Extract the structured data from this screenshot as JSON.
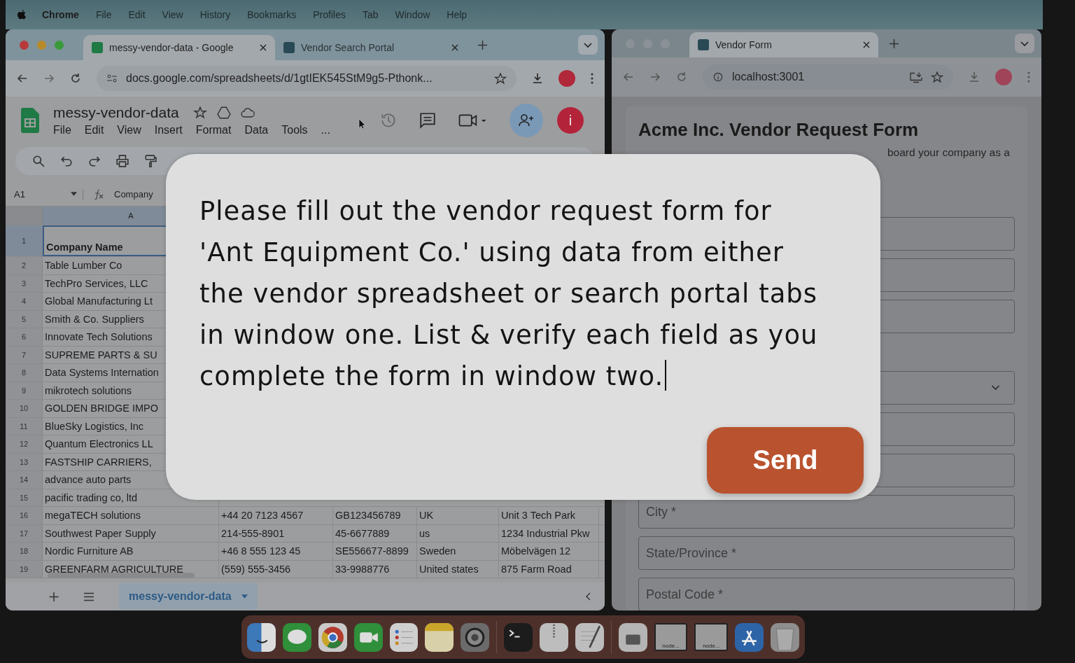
{
  "menu_bar": {
    "app": "Chrome",
    "items": [
      "File",
      "Edit",
      "View",
      "History",
      "Bookmarks",
      "Profiles",
      "Tab",
      "Window",
      "Help"
    ]
  },
  "window_one": {
    "tabs": [
      {
        "title": "messy-vendor-data - Google",
        "kind": "sheets",
        "selected": true
      },
      {
        "title": "Vendor Search Portal",
        "kind": "portal",
        "selected": false
      }
    ],
    "address": "docs.google.com/spreadsheets/d/1gtIEK545StM9g5-Pthonk...",
    "doc_title": "messy-vendor-data",
    "doc_menu": [
      "File",
      "Edit",
      "View",
      "Insert",
      "Format",
      "Data",
      "Tools",
      "..."
    ],
    "avatar_letter": "i",
    "name_box": "A1",
    "formula": "Company",
    "column_header": "A",
    "rows": [
      {
        "number": "1",
        "cells": [
          "Company Name"
        ]
      },
      {
        "number": "2",
        "cells": [
          "Table Lumber Co"
        ]
      },
      {
        "number": "3",
        "cells": [
          "TechPro Services, LLC"
        ]
      },
      {
        "number": "4",
        "cells": [
          "Global Manufacturing Lt"
        ]
      },
      {
        "number": "5",
        "cells": [
          "Smith & Co. Suppliers"
        ]
      },
      {
        "number": "6",
        "cells": [
          "Innovate Tech Solutions"
        ]
      },
      {
        "number": "7",
        "cells": [
          "SUPREME PARTS & SU"
        ]
      },
      {
        "number": "8",
        "cells": [
          "Data Systems Internation"
        ]
      },
      {
        "number": "9",
        "cells": [
          "mikrotech solutions"
        ]
      },
      {
        "number": "10",
        "cells": [
          "GOLDEN BRIDGE IMPO"
        ]
      },
      {
        "number": "11",
        "cells": [
          "BlueSky Logistics, Inc"
        ]
      },
      {
        "number": "12",
        "cells": [
          "Quantum Electronics LL"
        ]
      },
      {
        "number": "13",
        "cells": [
          "FASTSHIP CARRIERS,"
        ]
      },
      {
        "number": "14",
        "cells": [
          "advance auto parts"
        ]
      },
      {
        "number": "15",
        "cells": [
          "pacific trading co, ltd"
        ]
      },
      {
        "number": "16",
        "cells": [
          "megaTECH solutions",
          "+44 20 7123 4567",
          "GB123456789",
          "UK",
          "Unit 3 Tech Park"
        ]
      },
      {
        "number": "17",
        "cells": [
          "Southwest Paper Supply",
          "214-555-8901",
          "45-6677889",
          "us",
          "1234 Industrial Pkw"
        ]
      },
      {
        "number": "18",
        "cells": [
          "Nordic Furniture AB",
          "+46 8 555 123 45",
          "SE556677-8899",
          "Sweden",
          "Möbelvägen 12"
        ]
      },
      {
        "number": "19",
        "cells": [
          "GREENFARM AGRICULTURE",
          "(559) 555-3456",
          "33-9988776",
          "United states",
          "875 Farm Road"
        ]
      }
    ],
    "sheet_tab": "messy-vendor-data"
  },
  "window_two": {
    "tabs": [
      {
        "title": "Vendor Form",
        "kind": "portal",
        "selected": true
      }
    ],
    "address": "localhost:3001",
    "form_title": "Acme Inc. Vendor Request Form",
    "form_subtitle": "board your company as a",
    "sections": [
      {
        "fields": [
          {
            "kind": "text"
          },
          {
            "kind": "text"
          },
          {
            "kind": "text"
          }
        ]
      },
      {
        "fields": [
          {
            "kind": "select"
          },
          {
            "kind": "text"
          },
          {
            "kind": "text"
          },
          {
            "kind": "text",
            "placeholder": "City *"
          },
          {
            "kind": "text",
            "placeholder": "State/Province *"
          },
          {
            "kind": "text",
            "placeholder": "Postal Code *"
          }
        ]
      }
    ]
  },
  "prompt_dialog": {
    "message": "Please fill out the vendor request form for 'Ant Equipment Co.' using data from either the vendor spreadsheet or search portal tabs in window one. List & verify each field as you complete the form in window two.",
    "button": "Send"
  },
  "dock": {
    "items": [
      {
        "kind": "finder"
      },
      {
        "kind": "messages"
      },
      {
        "kind": "browser"
      },
      {
        "kind": "facetime"
      },
      {
        "kind": "reminders"
      },
      {
        "kind": "notes"
      },
      {
        "kind": "settings"
      },
      {
        "kind": "separator"
      },
      {
        "kind": "terminal"
      },
      {
        "kind": "archive"
      },
      {
        "kind": "textedit"
      },
      {
        "kind": "separator"
      },
      {
        "kind": "document"
      },
      {
        "kind": "window",
        "label": "node..."
      },
      {
        "kind": "window",
        "label": "node..."
      },
      {
        "kind": "appstore"
      },
      {
        "kind": "trash"
      }
    ]
  }
}
